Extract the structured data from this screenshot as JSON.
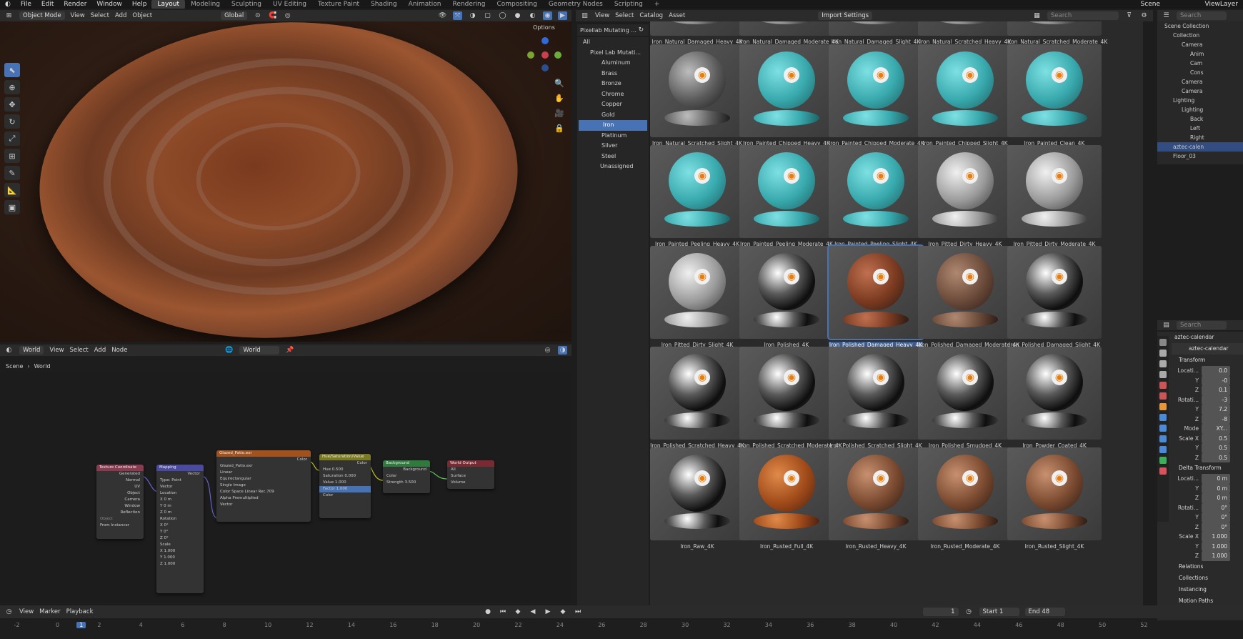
{
  "topbar": {
    "menus": [
      "File",
      "Edit",
      "Render",
      "Window",
      "Help"
    ],
    "workspaces": [
      "Layout",
      "Modeling",
      "Sculpting",
      "UV Editing",
      "Texture Paint",
      "Shading",
      "Animation",
      "Rendering",
      "Compositing",
      "Geometry Nodes",
      "Scripting"
    ],
    "add": "+",
    "scene": "Scene",
    "viewlayer": "ViewLayer"
  },
  "viewport_header": {
    "mode": "Object Mode",
    "menus": [
      "View",
      "Select",
      "Add",
      "Object"
    ],
    "transform": "Global",
    "options": "Options"
  },
  "node_header": {
    "editor": "World",
    "menus": [
      "View",
      "Select",
      "Add",
      "Node"
    ],
    "world": "World",
    "breadcrumb": [
      "Scene",
      "World"
    ]
  },
  "nodes": {
    "texcoord": {
      "title": "Texture Coordinate",
      "rows": [
        "Generated",
        "Normal",
        "UV",
        "Object",
        "Camera",
        "Window",
        "Reflection",
        "Object",
        "From Instancer"
      ]
    },
    "mapping": {
      "title": "Mapping",
      "rows": [
        "Vector",
        "Type:",
        "Point",
        "Vector",
        "Location",
        "X",
        "0 m",
        "Y",
        "0 m",
        "Z",
        "0 m",
        "Rotation",
        "X",
        "0°",
        "Y",
        "0°",
        "Z",
        "0°",
        "Scale",
        "X",
        "1.000",
        "Y",
        "1.000",
        "Z",
        "1.000"
      ]
    },
    "image": {
      "title": "Glazed_Patio.exr",
      "rows": [
        "Color",
        "Glazed_Patio.exr",
        "Linear",
        "Equirectangular",
        "Single Image",
        "Color Space",
        "Linear Rec.709",
        "Alpha",
        "Premultiplied",
        "Vector"
      ]
    },
    "hsv": {
      "title": "Hue/Saturation/Value",
      "rows": [
        "Color",
        "Hue",
        "0.500",
        "Saturation",
        "0.000",
        "Value",
        "1.000",
        "Factor",
        "1.000",
        "Color"
      ]
    },
    "bg": {
      "title": "Background",
      "rows": [
        "Background",
        "Color",
        "Strength",
        "3.500"
      ]
    },
    "out": {
      "title": "World Output",
      "rows": [
        "All",
        "Surface",
        "Volume"
      ]
    }
  },
  "asset_browser": {
    "menus": [
      "View",
      "Select",
      "Catalog",
      "Asset"
    ],
    "library": "Pixellab Mutating ...",
    "import": "Import Settings",
    "search": "Search",
    "tree": [
      "All",
      "Pixel Lab Mutati...",
      "Aluminum",
      "Brass",
      "Bronze",
      "Chrome",
      "Copper",
      "Gold",
      "Iron",
      "Platinum",
      "Silver",
      "Steel",
      "Unassigned"
    ],
    "assets": [
      "Iron_Natural_Damaged_Heavy_4K",
      "Iron_Natural_Damaged_Moderate_4K",
      "Iron_Natural_Damaged_Slight_4K",
      "Iron_Natural_Scratched_Heavy_4K",
      "Iron_Natural_Scratched_Moderate_4K",
      "Iron_Natural_Scratched_Slight_4K",
      "Iron_Painted_Chipped_Heavy_4K",
      "Iron_Painted_Chipped_Moderate_4K",
      "Iron_Painted_Chipped_Slight_4K",
      "Iron_Painted_Clean_4K",
      "Iron_Painted_Peeling_Heavy_4K",
      "Iron_Painted_Peeling_Moderate_4K",
      "Iron_Painted_Peeling_Slight_4K",
      "Iron_Pitted_Dirty_Heavy_4K",
      "Iron_Pitted_Dirty_Moderate_4K",
      "Iron_Pitted_Dirty_Slight_4K",
      "Iron_Polished_4K",
      "Iron_Polished_Damaged_Heavy_4K",
      "Iron_Polished_Damaged_Moderate_4K",
      "Iron_Polished_Damaged_Slight_4K",
      "Iron_Polished_Scratched_Heavy_4K",
      "Iron_Polished_Scratched_Moderate_4K",
      "Iron_Polished_Scratched_Slight_4K",
      "Iron_Polished_Smudged_4K",
      "Iron_Powder_Coated_4K",
      "Iron_Raw_4K",
      "Iron_Rusted_Full_4K",
      "Iron_Rusted_Heavy_4K",
      "Iron_Rusted_Moderate_4K",
      "Iron_Rusted_Slight_4K"
    ]
  },
  "outliner": {
    "rows": [
      "Scene Collection",
      "Collection",
      "Camera",
      "Anim",
      "Cam",
      "Cons",
      "Camera",
      "Camera",
      "Lighting",
      "Lighting",
      "Back",
      "Left",
      "Right",
      "aztec-calen",
      "Floor_03"
    ]
  },
  "properties": {
    "search": "Search",
    "object": "aztec-calendar",
    "data": "aztec-calendar",
    "transform": "Transform",
    "rows": [
      [
        "Locati...",
        "0.0"
      ],
      [
        "Y",
        "-0"
      ],
      [
        "Z",
        "0.1"
      ],
      [
        "Rotati...",
        "-3"
      ],
      [
        "Y",
        "7.2"
      ],
      [
        "Z",
        "-8"
      ],
      [
        "Mode",
        "XY..."
      ],
      [
        "Scale X",
        "0.5"
      ],
      [
        "Y",
        "0.5"
      ],
      [
        "Z",
        "0.5"
      ]
    ],
    "delta": "Delta Transform",
    "drows": [
      [
        "Locati...",
        "0 m"
      ],
      [
        "Y",
        "0 m"
      ],
      [
        "Z",
        "0 m"
      ],
      [
        "Rotati...",
        "0°"
      ],
      [
        "Y",
        "0°"
      ],
      [
        "Z",
        "0°"
      ],
      [
        "Scale X",
        "1.000"
      ],
      [
        "Y",
        "1.000"
      ],
      [
        "Z",
        "1.000"
      ]
    ],
    "sections": [
      "Relations",
      "Collections",
      "Instancing",
      "Motion Paths"
    ]
  },
  "timeline": {
    "menus": [
      "View",
      "Marker",
      "Playback"
    ],
    "frame": "1",
    "start_label": "Start",
    "start": "1",
    "end_label": "End",
    "end": "48",
    "ticks": [
      "-2",
      "0",
      "1",
      "2",
      "4",
      "6",
      "8",
      "10",
      "12",
      "14",
      "16",
      "18",
      "20",
      "22",
      "24",
      "26",
      "28",
      "30",
      "32",
      "34",
      "36",
      "38",
      "40",
      "42",
      "44",
      "46",
      "48",
      "50",
      "52"
    ]
  }
}
